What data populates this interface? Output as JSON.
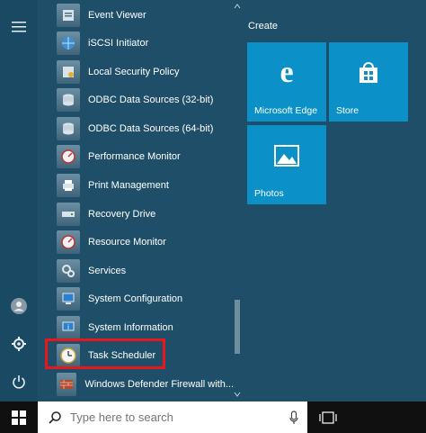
{
  "apps": [
    {
      "label": "Event Viewer",
      "icon": "event-viewer-icon"
    },
    {
      "label": "iSCSI Initiator",
      "icon": "globe-icon"
    },
    {
      "label": "Local Security Policy",
      "icon": "security-policy-icon"
    },
    {
      "label": "ODBC Data Sources (32-bit)",
      "icon": "database-icon"
    },
    {
      "label": "ODBC Data Sources (64-bit)",
      "icon": "database-icon"
    },
    {
      "label": "Performance Monitor",
      "icon": "monitor-gauge-icon"
    },
    {
      "label": "Print Management",
      "icon": "printer-icon"
    },
    {
      "label": "Recovery Drive",
      "icon": "drive-icon"
    },
    {
      "label": "Resource Monitor",
      "icon": "monitor-gauge-icon"
    },
    {
      "label": "Services",
      "icon": "gears-icon"
    },
    {
      "label": "System Configuration",
      "icon": "system-config-icon"
    },
    {
      "label": "System Information",
      "icon": "system-info-icon"
    },
    {
      "label": "Task Scheduler",
      "icon": "clock-icon"
    },
    {
      "label": "Windows Defender Firewall with...",
      "icon": "firewall-icon"
    }
  ],
  "tiles": {
    "group_title": "Create",
    "edge": "Microsoft Edge",
    "store": "Store",
    "photos": "Photos"
  },
  "search": {
    "placeholder": "Type here to search"
  },
  "colors": {
    "tile": "#0b91c8",
    "highlight": "#e8171c"
  }
}
